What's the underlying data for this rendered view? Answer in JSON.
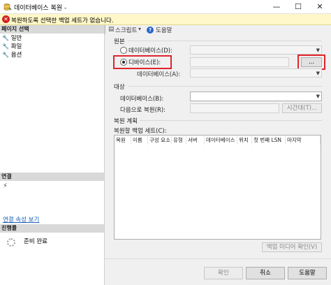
{
  "window": {
    "title": "데이터베이스 복원 -",
    "buttons": {
      "minimize": "—",
      "maximize": "☐",
      "close": "✕"
    }
  },
  "error_bar": {
    "icon": "error-icon",
    "text": "복원하도록 선택한 백업 세트가 없습니다."
  },
  "left_pane": {
    "page_select_header": "페이지 선택",
    "pages": [
      {
        "label": "일반",
        "icon": "wrench-icon"
      },
      {
        "label": "파일",
        "icon": "wrench-icon"
      },
      {
        "label": "옵션",
        "icon": "wrench-icon"
      }
    ],
    "connection_header": "연결",
    "connection_link": "연결 속성 보기",
    "progress_header": "진행률",
    "progress_status": "준비 완료"
  },
  "toolbar": {
    "script_label": "스크립트",
    "help_label": "도움말"
  },
  "source": {
    "group_title": "원본",
    "database_radio_label": "데이터베이스(D):",
    "device_radio_label": "디바이스(E):",
    "browse_button": "...",
    "device_database_label": "데이터베이스(A):",
    "selected": "device"
  },
  "destination": {
    "group_title": "대상",
    "database_label": "데이터베이스(B):",
    "restore_to_label": "다음으로 복원(R):",
    "timeline_button": "시간대(T)..."
  },
  "restore_plan": {
    "group_title": "복원 계획",
    "backup_sets_label": "복원할 백업 세트(C):",
    "columns": [
      "복원",
      "이름",
      "구성 요소",
      "유형",
      "서버",
      "데이터베이스",
      "위치",
      "첫 번째 LSN",
      "마지막"
    ],
    "verify_button": "백업 미디어 확인(V)"
  },
  "footer": {
    "ok": "확인",
    "cancel": "취소",
    "help": "도움말"
  },
  "colors": {
    "accent_red": "#e0242c",
    "link_blue": "#1a5fb4",
    "error_bg": "#fff7c8"
  }
}
